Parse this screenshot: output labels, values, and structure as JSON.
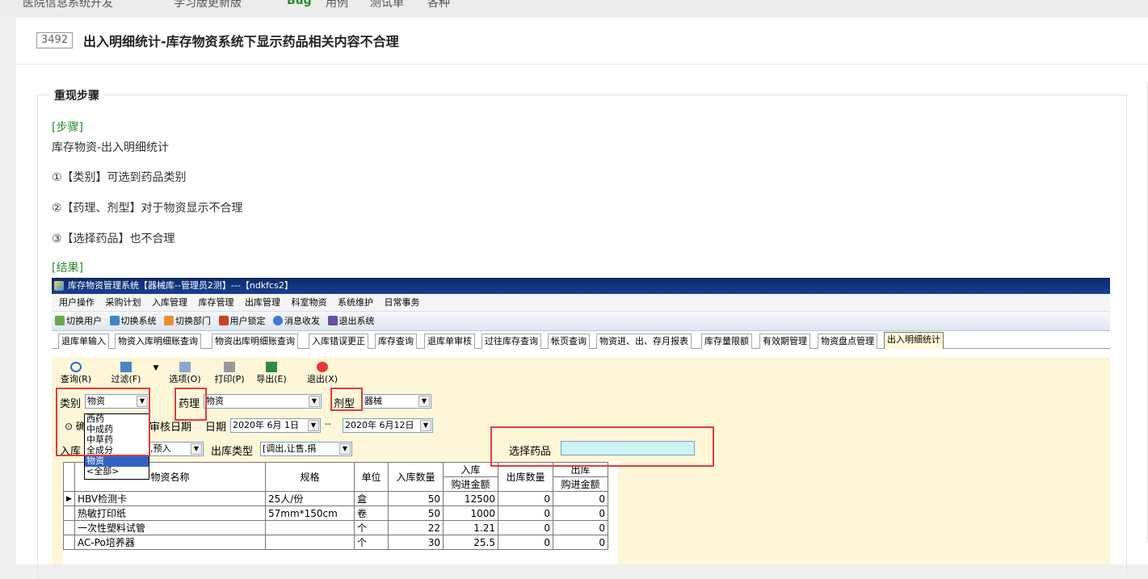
{
  "page": {
    "top_strip": [
      "医院信息系统开发",
      "学习版更新版",
      "Bug",
      "用例",
      "测试单",
      "各种"
    ],
    "bug_id": "3492",
    "bug_title": "出入明细统计-库存物资系统下显示药品相关内容不合理",
    "section_legend": "重现步骤",
    "steps_label": "[步骤]",
    "step_intro": "库存物资-出入明细统计",
    "step1": "①【类别】可选到药品类别",
    "step2": "②【药理、剂型】对于物资显示不合理",
    "step3": "③【选择药品】也不合理",
    "result_label": "[结果]"
  },
  "app": {
    "window_title": "库存物资管理系统【器械库--管理员2测】---【ndkfcs2】",
    "menu": [
      "用户操作",
      "采购计划",
      "入库管理",
      "库存管理",
      "出库管理",
      "科室物资",
      "系统维护",
      "日常事务"
    ],
    "toolbar": [
      "切换用户",
      "切换系统",
      "切换部门",
      "用户锁定",
      "消息收发",
      "退出系统"
    ],
    "tabs": [
      "退库单输入",
      "物资入库明细账查询",
      "物资出库明细账查询",
      "入库错误更正",
      "库存查询",
      "退库单审核",
      "过往库存查询",
      "帐页查询",
      "物资进、出、存月报表",
      "库存量限额",
      "有效期管理",
      "物资盘点管理",
      "出入明细统计"
    ],
    "active_tab": "出入明细统计",
    "tool_buttons": [
      "查询(R)",
      "过滤(F)",
      "选项(O)",
      "打印(P)",
      "导出(E)",
      "退出(X)"
    ],
    "filters": {
      "category_label": "类别",
      "category_value": "物资",
      "pharmacology_label": "药理",
      "pharmacology_value": "物资",
      "dosage_label": "剂型",
      "dosage_value": "器械",
      "radio_label": "确",
      "audit_date": "审核日期",
      "date_label": "日期",
      "date_from": "2020年 6月 1日",
      "date_sep": "--",
      "date_to": "2020年 6月12日",
      "in_type_label": "入库",
      "in_type_value": "库,预入",
      "out_type_label": "出库类型",
      "out_type_value": "[调出,让售,捐",
      "select_drug_label": "选择药品"
    },
    "category_options": [
      "西药",
      "中成药",
      "中草药",
      "全成分",
      "物资",
      "<全部>"
    ],
    "category_selected": "物资",
    "grid": {
      "headers": [
        "物资名称",
        "规格",
        "单位",
        "入库数量",
        "入库",
        "购进金额",
        "出库数量",
        "出库",
        "购进金额"
      ],
      "rows": [
        [
          "HBV检测卡",
          "25人/份",
          "盒",
          "50",
          "12500",
          "0",
          "0"
        ],
        [
          "热敏打印纸",
          "57mm*150cm",
          "卷",
          "50",
          "1000",
          "0",
          "0"
        ],
        [
          "一次性塑料试管",
          "",
          "个",
          "22",
          "1.21",
          "0",
          "0"
        ],
        [
          "AC-Po培养器",
          "",
          "个",
          "30",
          "25.5",
          "0",
          "0"
        ]
      ]
    }
  }
}
